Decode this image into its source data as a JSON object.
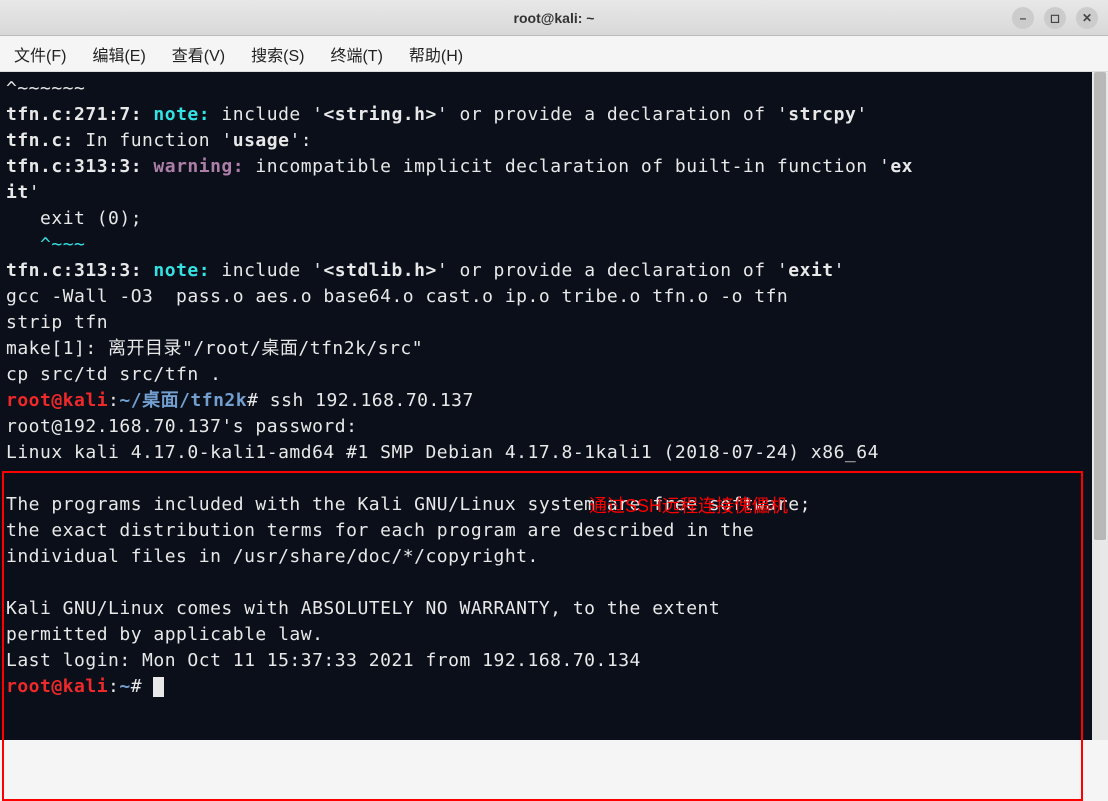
{
  "window": {
    "title": "root@kali: ~"
  },
  "menu": {
    "file": "文件(F)",
    "edit": "编辑(E)",
    "view": "查看(V)",
    "search": "搜索(S)",
    "terminal": "终端(T)",
    "help": "帮助(H)"
  },
  "terminal": {
    "partial_line": "^~~~~~~",
    "line1_loc": "tfn.c:271:7:",
    "line1_note": "note:",
    "line1_pre": " include '",
    "line1_hdr": "<string.h>",
    "line1_mid": "' or provide a declaration of '",
    "line1_fn": "strcpy",
    "line1_end": "'",
    "line2_loc": "tfn.c:",
    "line2_txt": " In function '",
    "line2_fn": "usage",
    "line2_end": "':",
    "line3_loc": "tfn.c:313:3:",
    "line3_warn": "warning:",
    "line3_txt": " incompatible implicit declaration of built-in function '",
    "line3_fn": "ex\nit",
    "line3_end": "'",
    "line4": "   exit (0);",
    "line5_pre": "   ",
    "line5_caret": "^",
    "line5_tilde": "~~~",
    "line6_loc": "tfn.c:313:3:",
    "line6_note": "note:",
    "line6_pre": " include '",
    "line6_hdr": "<stdlib.h>",
    "line6_mid": "' or provide a declaration of '",
    "line6_fn": "exit",
    "line6_end": "'",
    "line7": "gcc -Wall -O3  pass.o aes.o base64.o cast.o ip.o tribe.o tfn.o -o tfn",
    "line8": "strip tfn",
    "line9": "make[1]: 离开目录\"/root/桌面/tfn2k/src\"",
    "line10": "cp src/td src/tfn .",
    "prompt1_user": "root@kali",
    "prompt1_sep": ":",
    "prompt1_path": "~/桌面/tfn2k",
    "prompt1_hash": "#",
    "prompt1_cmd": " ssh 192.168.70.137",
    "line_pwd": "root@192.168.70.137's password:",
    "line_linux": "Linux kali 4.17.0-kali1-amd64 #1 SMP Debian 4.17.8-1kali1 (2018-07-24) x86_64",
    "line_blank": "",
    "line_p1": "The programs included with the Kali GNU/Linux system are free software;",
    "line_p2": "the exact distribution terms for each program are described in the",
    "line_p3": "individual files in /usr/share/doc/*/copyright.",
    "line_w1": "Kali GNU/Linux comes with ABSOLUTELY NO WARRANTY, to the extent",
    "line_w2": "permitted by applicable law.",
    "line_last": "Last login: Mon Oct 11 15:37:33 2021 from 192.168.70.134",
    "prompt2_user": "root@kali",
    "prompt2_sep": ":",
    "prompt2_path": "~",
    "prompt2_hash": "#",
    "prompt2_cmd": " "
  },
  "annotation": {
    "text": "通过SSH远程连接傀儡机"
  }
}
